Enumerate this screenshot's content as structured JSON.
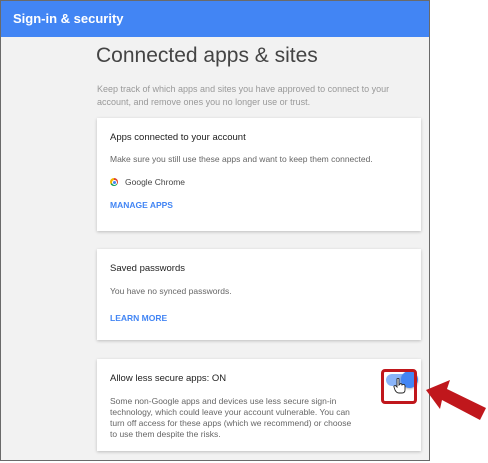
{
  "topbar": {
    "title": "Sign-in & security"
  },
  "page": {
    "title": "Connected apps & sites",
    "intro": "Keep track of which apps and sites you have approved to connect to your account, and remove ones you no longer use or trust."
  },
  "cards": {
    "apps": {
      "title": "Apps connected to your account",
      "desc": "Make sure you still use these apps and want to keep them connected.",
      "app_name": "Google Chrome",
      "link": "MANAGE APPS"
    },
    "passwords": {
      "title": "Saved passwords",
      "desc": "You have no synced passwords.",
      "link": "LEARN MORE"
    },
    "secure": {
      "title": "Allow less secure apps: ON",
      "desc": "Some non-Google apps and devices use less secure sign-in technology, which could leave your account vulnerable. You can turn off access for these apps (which we recommend) or choose to use them despite the risks.",
      "toggle_on": true
    }
  },
  "colors": {
    "accent": "#4285f4",
    "highlight": "#c0171c",
    "background": "#f2f2f2"
  },
  "icons": [
    "chrome-icon",
    "hand-cursor-icon",
    "red-arrow-icon"
  ]
}
